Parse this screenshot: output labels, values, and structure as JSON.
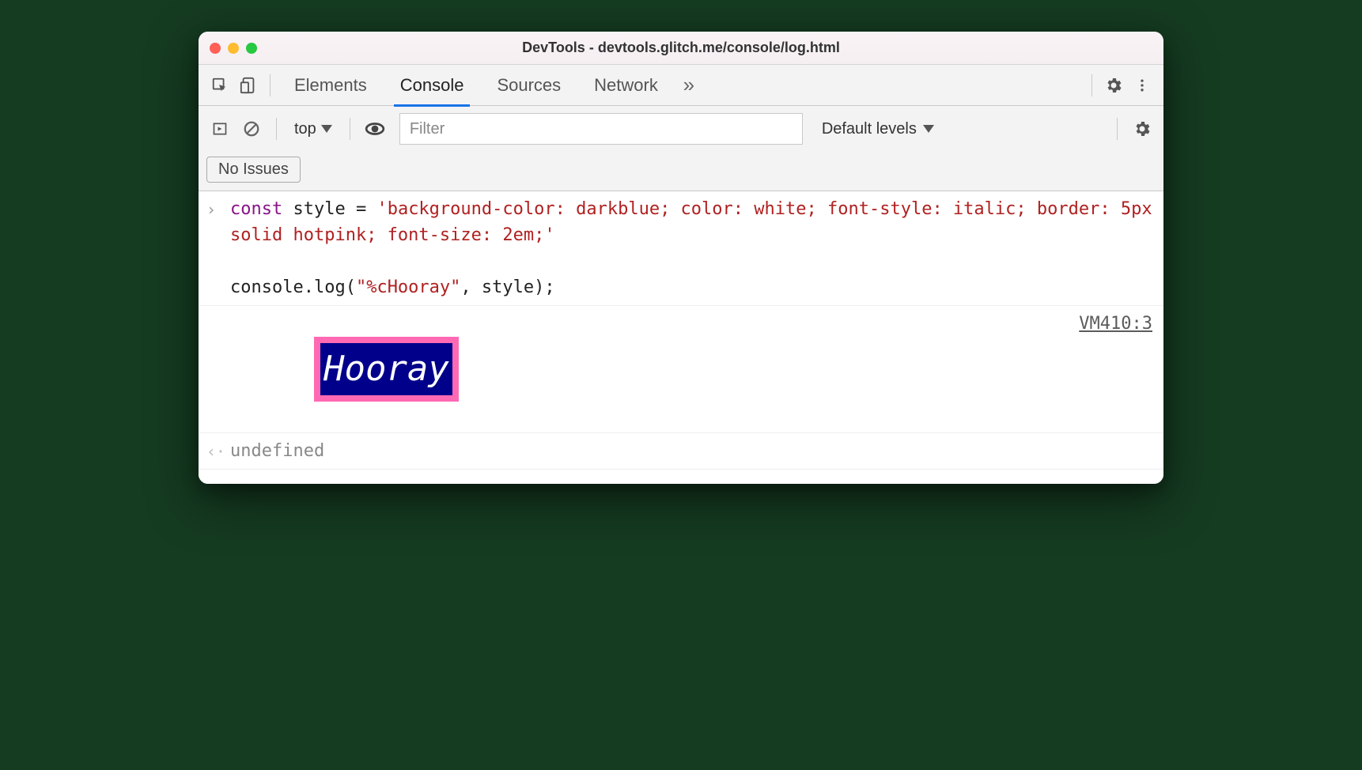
{
  "window": {
    "title": "DevTools - devtools.glitch.me/console/log.html"
  },
  "tabs": {
    "elements": "Elements",
    "console": "Console",
    "sources": "Sources",
    "network": "Network"
  },
  "subbar": {
    "context": "top",
    "filter_placeholder": "Filter",
    "levels": "Default levels"
  },
  "issues": {
    "label": "No Issues"
  },
  "console": {
    "input_code_html": "<span class=\"kw\">const</span><span class=\"plain\"> style = </span><span class=\"str\">'background-color: darkblue; color: white; font-style: italic; border: 5px solid hotpink; font-size: 2em;'</span><span class=\"plain\">\n\nconsole.log(</span><span class=\"str\">\"%cHooray\"</span><span class=\"plain\">, style);</span>",
    "output_text": "Hooray",
    "source_link": "VM410:3",
    "return_value": "undefined"
  }
}
